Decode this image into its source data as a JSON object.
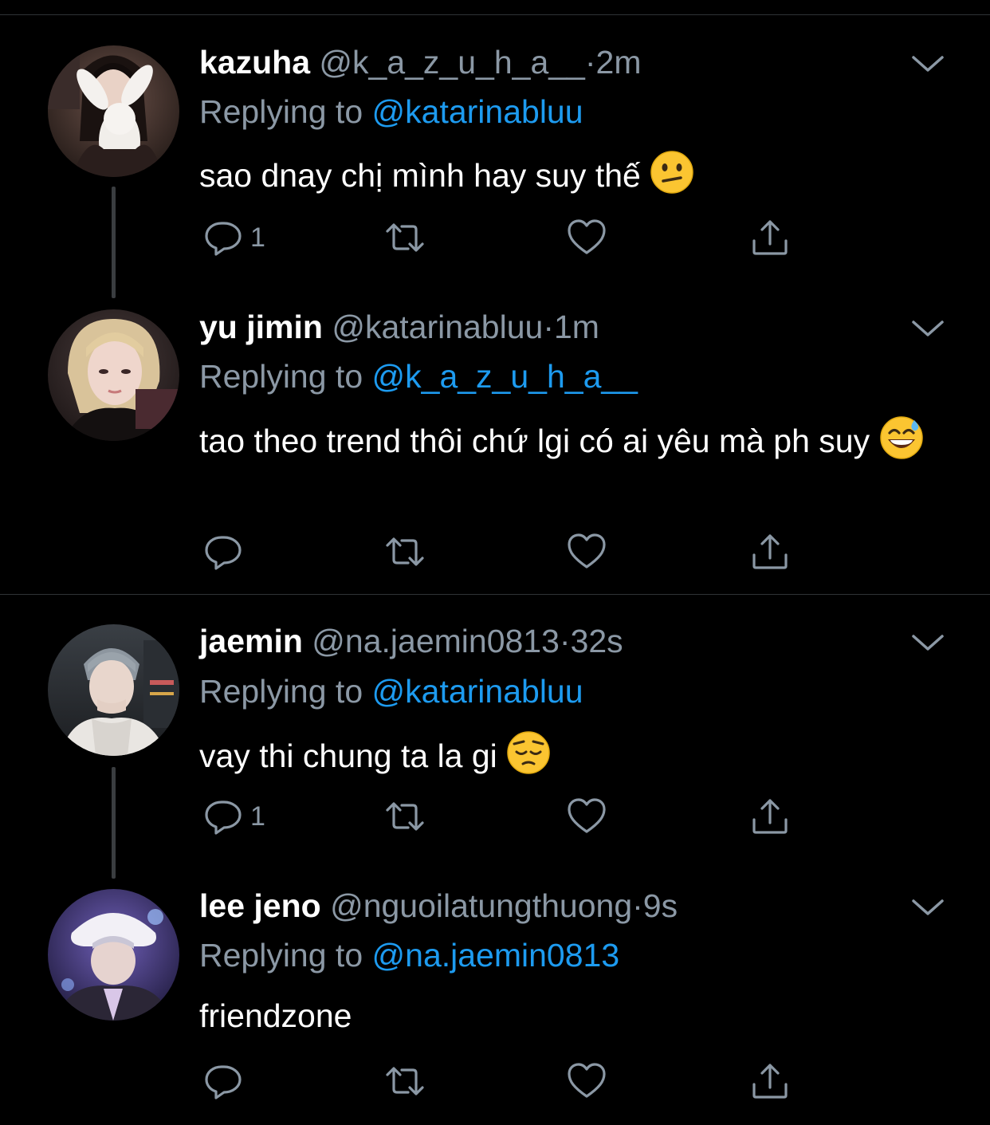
{
  "colors": {
    "background": "#000000",
    "text": "#ffffff",
    "secondary": "#8b98a5",
    "mention": "#1d9bf0",
    "divider": "#2f3336"
  },
  "tweets": [
    {
      "display_name": "kazuha",
      "handle": "@k_a_z_u_h_a__",
      "dot": "·",
      "time": "2m",
      "replying_prefix": "Replying to",
      "replying_to": "@katarinabluu",
      "text": "sao dnay chị mình hay suy thế",
      "emoji": "confused-face",
      "reply_count": "1",
      "icons": [
        "reply-icon",
        "retweet-icon",
        "like-icon",
        "share-icon",
        "chevron-down-icon"
      ]
    },
    {
      "display_name": "yu jimin",
      "handle": "@katarinabluu",
      "dot": "·",
      "time": "1m",
      "replying_prefix": "Replying to",
      "replying_to": "@k_a_z_u_h_a__",
      "text": "tao theo trend thôi chứ lgi có ai yêu mà ph suy",
      "emoji": "grinning-face-with-sweat",
      "reply_count": "",
      "icons": [
        "reply-icon",
        "retweet-icon",
        "like-icon",
        "share-icon",
        "chevron-down-icon"
      ]
    },
    {
      "display_name": "jaemin",
      "handle": "@na.jaemin0813",
      "dot": "·",
      "time": "32s",
      "replying_prefix": "Replying to",
      "replying_to": "@katarinabluu",
      "text": "vay thi chung ta la gi",
      "emoji": "pensive-face",
      "reply_count": "1",
      "icons": [
        "reply-icon",
        "retweet-icon",
        "like-icon",
        "share-icon",
        "chevron-down-icon"
      ]
    },
    {
      "display_name": "lee jeno",
      "handle": "@nguoilatungthuong",
      "dot": "·",
      "time": "9s",
      "replying_prefix": "Replying to",
      "replying_to": "@na.jaemin0813",
      "text": "friendzone",
      "emoji": "",
      "reply_count": "",
      "icons": [
        "reply-icon",
        "retweet-icon",
        "like-icon",
        "share-icon",
        "chevron-down-icon"
      ]
    }
  ]
}
